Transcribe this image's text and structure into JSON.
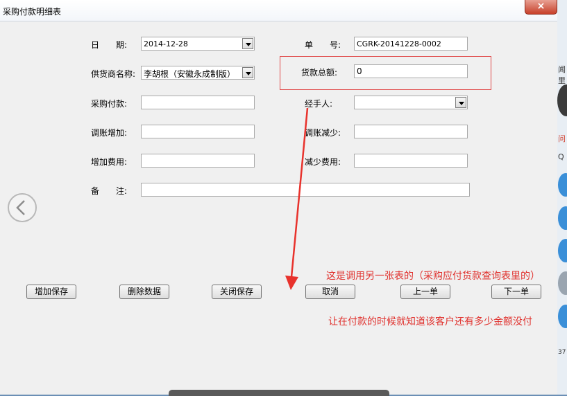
{
  "window": {
    "title": "采购付款明细表",
    "close_label": "×"
  },
  "form": {
    "date": {
      "label": "日　　期:",
      "value": "2014-12-28"
    },
    "order_no": {
      "label": "单　　号:",
      "value": "CGRK-20141228-0002"
    },
    "supplier": {
      "label": "供货商名称:",
      "value": "李胡根（安徽永成制版）"
    },
    "total": {
      "label": "货款总额:",
      "value": "0"
    },
    "payment": {
      "label": "采购付款:",
      "value": ""
    },
    "handler": {
      "label": "经手人:",
      "value": ""
    },
    "adjust_inc": {
      "label": "调账增加:",
      "value": ""
    },
    "adjust_dec": {
      "label": "调账减少:",
      "value": ""
    },
    "fee_inc": {
      "label": "增加费用:",
      "value": ""
    },
    "fee_dec": {
      "label": "减少费用:",
      "value": ""
    },
    "remark": {
      "label": "备　　注:",
      "value": ""
    }
  },
  "buttons": {
    "add_save": "增加保存",
    "delete": "删除数据",
    "close_save": "关闭保存",
    "cancel": "取消",
    "prev": "上一单",
    "next": "下一单"
  },
  "annotations": {
    "note1": "这是调用另一张表的（采购应付货款查询表里的）",
    "note2": "让在付款的时候就知道该客户还有多少金额没付",
    "arrow_color": "#e8322c"
  },
  "side": {
    "t1": "闻里",
    "t2": "问",
    "t3": "Q",
    "t4": "37"
  }
}
